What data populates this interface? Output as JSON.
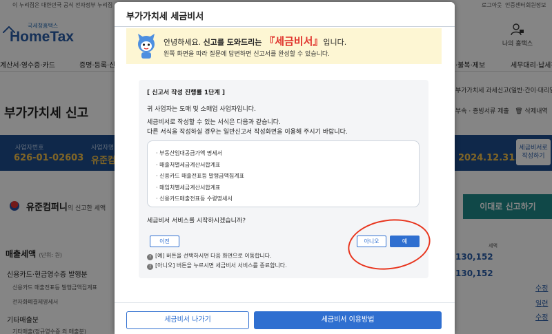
{
  "background": {
    "topbar": {
      "notice": "이 누리집은 대한민국 공식 전자정부 누리집",
      "login": "로그아웃",
      "cert": "인증센터",
      "signup": "회원정보"
    },
    "logo": {
      "small": "국세청홈택스",
      "text": "HomeTax"
    },
    "my_home": "나의 홈택스",
    "nav": [
      "계산서·영수증·카드",
      "증명·등록·신",
      "·불복·제보",
      "세무대리·납세관"
    ],
    "sub_nav": "부가가치세 과세신고(일반·간이·대리일",
    "page_title": "부가가치세 신고",
    "page_links": {
      "attach": "부속 · 증빙서류 제출",
      "delete": "삭제내역"
    },
    "info_band": {
      "biz_no_label": "사업자번호",
      "biz_no": "626-01-02603",
      "name_label": "사업자명",
      "name": "유준컴",
      "date": "2024.12.31.",
      "side_button": "세금비서로 작성하기"
    },
    "company": {
      "name": "유준컴퍼니",
      "suffix": "의 신고한 세액"
    },
    "report_button": "이대로 신고하기",
    "sales": {
      "title": "매출세액",
      "unit": "(단위: 원)",
      "column_header": "세액",
      "rows": [
        {
          "label": "신용카드·현금영수증 발행분",
          "sub": false
        },
        {
          "label": "신용카드 매출전표등 발행금액집계표",
          "sub": true
        },
        {
          "label": "전자화폐결제명세서",
          "sub": true
        },
        {
          "label": "기타매출분",
          "sub": false
        },
        {
          "label": "기타매출(정규영수증 외 매출분)",
          "sub": true
        }
      ],
      "amounts": [
        "130,152",
        "130,152"
      ],
      "right_links": [
        "수정",
        "일련",
        "수정"
      ]
    }
  },
  "modal": {
    "title": "부가가치세 세금비서",
    "banner": {
      "greeting": "안녕하세요. ",
      "bold": "신고를 도와드리는 ",
      "highlight": "『세금비서』",
      "tail": "입니다.",
      "line2": "왼쪽 화면을 따라 질문에 답변하면 신고서를 완성할 수 있습니다."
    },
    "step": {
      "title": "[ 신고서 작성 진행률 1단계 ]",
      "line1": "귀 사업자는 도매 및 소매업 사업자입니다.",
      "line2": "세금비서로 작성할 수 있는 서식은 다음과 같습니다.",
      "line3": "다른 서식을 작성하실 경우는 일반신고서 작성화면을 이용해 주시기 바랍니다.",
      "forms": [
        "부동산임대공급가액 명세서",
        "매출처별세금계산서합계표",
        "신용카드 매출전표등 발행금액집계표",
        "매입처별세금계산서합계표",
        "신용카드매출전표등 수령명세서"
      ],
      "question": "세금비서 서비스를 시작하시겠습니까?",
      "btn_prev": "이전",
      "btn_no": "아니오",
      "btn_yes": "예",
      "note1": "[예] 버튼을 선택하시면 다음 화면으로 이동합니다.",
      "note2": "[아니오] 버튼을 누르시면 세금비서 서비스를 종료합니다.",
      "note_icon": "!"
    },
    "footer": {
      "exit": "세금비서 나가기",
      "guide": "세금비서 이용방법"
    }
  },
  "colors": {
    "primary": "#2f6fd0",
    "highlight": "#e0322c",
    "banner_bg": "#fdf6d3",
    "annotation": "#e8351e"
  }
}
